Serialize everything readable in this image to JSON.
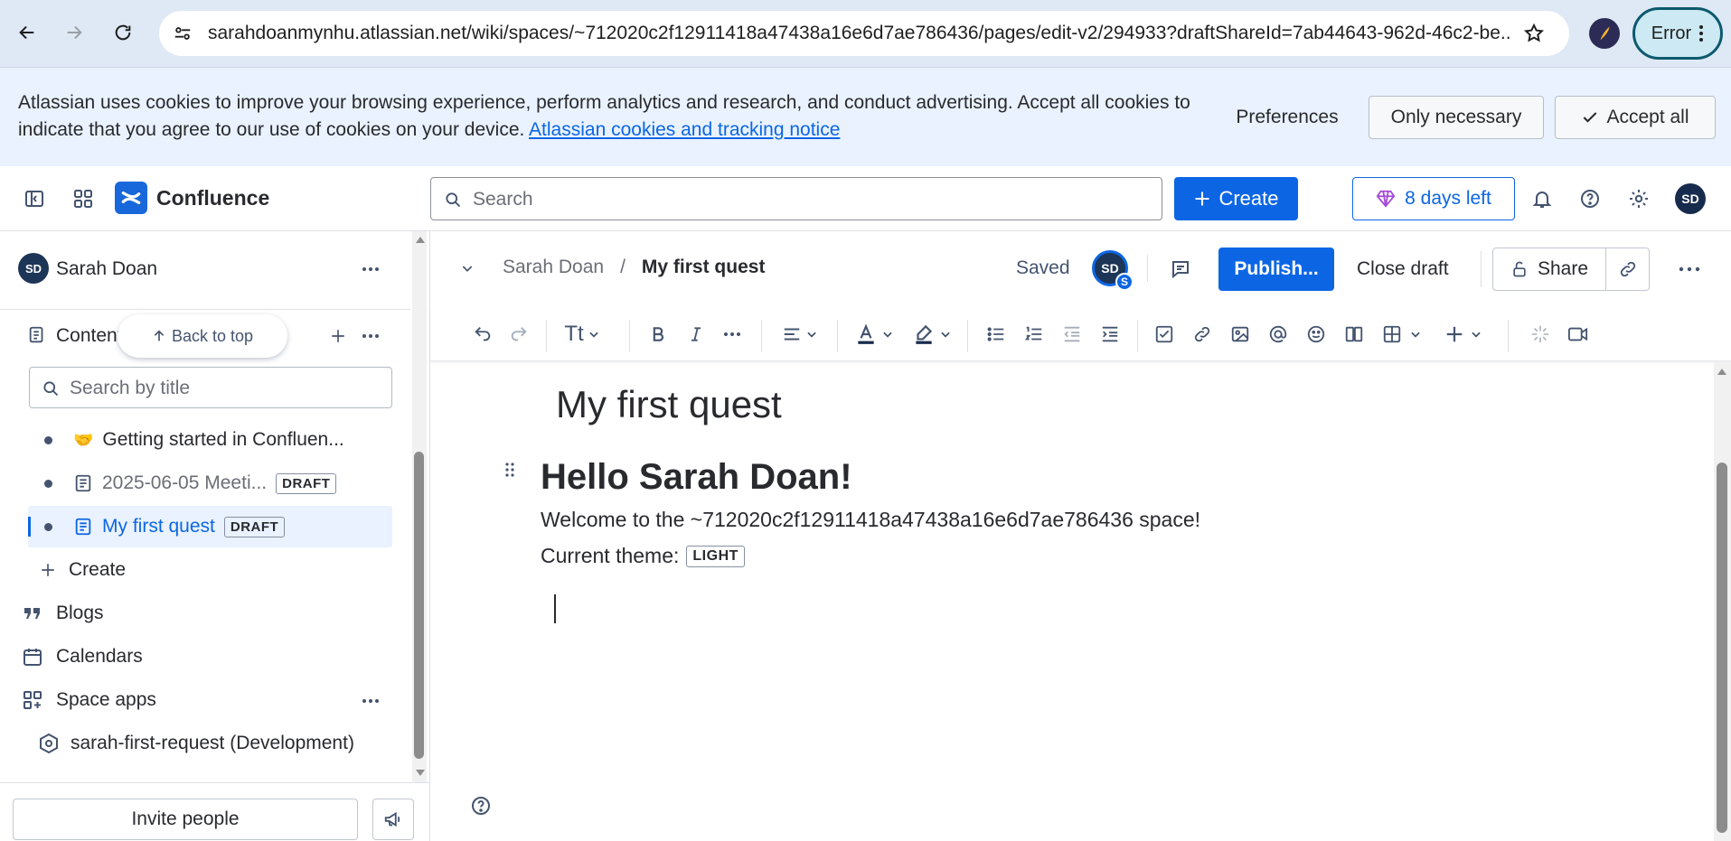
{
  "browser": {
    "url": "sarahdoanmynhu.atlassian.net/wiki/spaces/~712020c2f12911418a47438a16e6d7ae786436/pages/edit-v2/294933?draftShareId=7ab44643-962d-46c2-be...",
    "profile_status": "Error"
  },
  "cookie_banner": {
    "text": "Atlassian uses cookies to improve your browsing experience, perform analytics and research, and conduct advertising. Accept all cookies to indicate that you agree to our use of cookies on your device.",
    "link_text": "Atlassian cookies and tracking notice",
    "preferences": "Preferences",
    "only_necessary": "Only necessary",
    "accept_all": "Accept all"
  },
  "topnav": {
    "product": "Confluence",
    "search_placeholder": "Search",
    "create": "Create",
    "trial": "8 days left",
    "user_initials": "SD"
  },
  "sidebar": {
    "space_name": "Sarah Doan",
    "space_initials": "SD",
    "content_label": "Content",
    "back_to_top": "Back to top",
    "search_placeholder": "Search by title",
    "tree": [
      {
        "emoji": "🤝",
        "label": "Getting started in Confluen..."
      },
      {
        "label": "2025-06-05 Meeti...",
        "badge": "DRAFT"
      },
      {
        "label": "My first quest",
        "badge": "DRAFT"
      }
    ],
    "create": "Create",
    "blogs": "Blogs",
    "calendars": "Calendars",
    "space_apps": "Space apps",
    "app_item": "sarah-first-request (Development)",
    "invite": "Invite people"
  },
  "editor": {
    "breadcrumb_space": "Sarah Doan",
    "breadcrumb_sep": "/",
    "breadcrumb_page": "My first quest",
    "status": "Saved",
    "collab_initials": "SD",
    "collab_badge": "S",
    "publish": "Publish...",
    "close_draft": "Close draft",
    "share": "Share",
    "toolbar_text_style": "Tt",
    "title": "My first quest",
    "heading": "Hello Sarah Doan!",
    "welcome": "Welcome to the ~712020c2f12911418a47438a16e6d7ae786436 space!",
    "theme_label": "Current theme:",
    "theme_value": "LIGHT"
  },
  "colors": {
    "accent": "#0c66e4",
    "chrome_bg": "#dfe8f5",
    "banner_bg": "#e9f2fe",
    "selected_bg": "#e9f2fe"
  }
}
